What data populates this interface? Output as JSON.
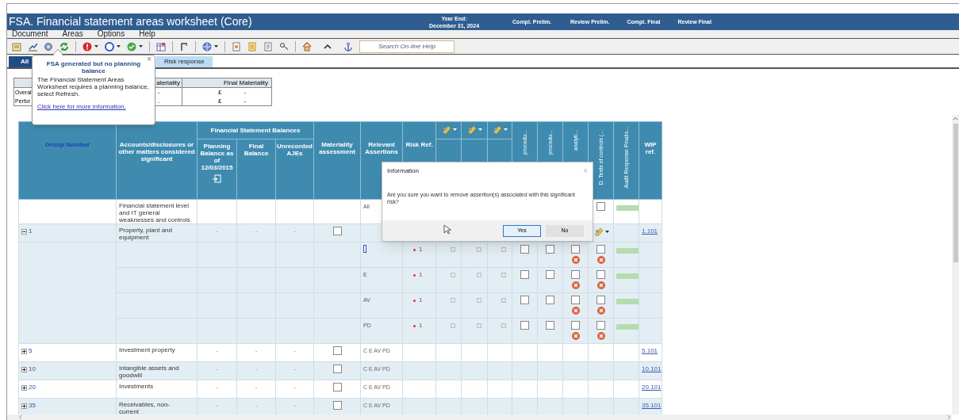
{
  "window": {
    "title": "FSA. Financial statement areas worksheet (Core)"
  },
  "header_fields": [
    {
      "label": "Year End:",
      "value": "December 31, 2024"
    },
    {
      "label": "Compl. Prelim."
    },
    {
      "label": "Review Prelim."
    },
    {
      "label": "Compl. Final"
    },
    {
      "label": "Review Final"
    }
  ],
  "menu": [
    "Document",
    "Areas",
    "Options",
    "Help"
  ],
  "toolbar": {
    "search_placeholder": "Search On-line Help"
  },
  "tabs": [
    {
      "label": "All",
      "selected": true
    },
    {
      "label": "Risk response",
      "selected": false
    }
  ],
  "materiality": {
    "columns": [
      "ateriality",
      "Final Materiality"
    ],
    "rows": [
      {
        "label": "Overal",
        "prelim": "-",
        "currency": "£",
        "final": "-"
      },
      {
        "label": "Perfor",
        "prelim": ".",
        "currency": "£",
        "final": "-"
      }
    ]
  },
  "popup": {
    "title": "FSA generated but no planning balance",
    "text": "The Financial Statement Areas Worksheet requires a planning balance, select Refresh.",
    "link": "Click here for more information.",
    "close": "×"
  },
  "table": {
    "balances_group": "Financial Statement Balances",
    "columns": [
      {
        "kind": "group_heading",
        "label": "Group Number"
      },
      {
        "kind": "text",
        "label": "Accounts/disclosures or other matters considered significant"
      },
      {
        "kind": "import",
        "label": "Planning Balance as of 12/03/2015"
      },
      {
        "kind": "text",
        "label": "Final Balance"
      },
      {
        "kind": "text",
        "label": "Unrecorded AJEs"
      },
      {
        "kind": "text",
        "label": "Materiality assessment"
      },
      {
        "kind": "text",
        "label": "Relevant Assertions"
      },
      {
        "kind": "text",
        "label": "Risk Ref."
      },
      {
        "kind": "icon_menu"
      },
      {
        "kind": "icon_menu"
      },
      {
        "kind": "icon_menu"
      },
      {
        "kind": "rotated_top",
        "label": "procedu..."
      },
      {
        "kind": "rotated_top",
        "label": "procedu..."
      },
      {
        "kind": "rotated_top",
        "label": "analyti..."
      },
      {
        "kind": "rotated",
        "label": "D. Tests of controls (..."
      },
      {
        "kind": "rotated",
        "label": "Audit Response Finalis..."
      },
      {
        "kind": "text",
        "label": "WIP ref."
      }
    ],
    "rows": [
      {
        "kind": "level",
        "name": "Financial statement level and IT general weaknesses and controls",
        "assertions": "All",
        "tests_checked": false
      },
      {
        "kind": "area",
        "group": "1",
        "expanded": true,
        "name": "Property, plant and equipment",
        "planning": "-",
        "final": "-",
        "unrecorded": "-",
        "materiality_checked": false,
        "wip": "1.101"
      },
      {
        "kind": "assertion",
        "editing": true,
        "risk": "1",
        "checks": [
          false,
          false,
          false,
          false
        ]
      },
      {
        "kind": "assertion",
        "assertion": "E",
        "risk": "1",
        "checks": [
          false,
          false,
          false,
          false
        ]
      },
      {
        "kind": "assertion",
        "assertion": "AV",
        "risk": "1",
        "checks": [
          false,
          false,
          false,
          false
        ]
      },
      {
        "kind": "assertion",
        "assertion": "PD",
        "risk": "1",
        "checks": [
          false,
          false,
          false,
          false
        ]
      },
      {
        "kind": "area",
        "group": "5",
        "expanded": false,
        "name": "Investment property",
        "planning": "-",
        "final": "-",
        "unrecorded": "-",
        "materiality_checked": false,
        "assertions": "C E AV PD",
        "wip": "5.101"
      },
      {
        "kind": "area",
        "group": "10",
        "expanded": false,
        "name": "Intangible assets and goodwill",
        "planning": "-",
        "final": "-",
        "unrecorded": "-",
        "materiality_checked": false,
        "assertions": "C E AV PD",
        "wip": "10.101"
      },
      {
        "kind": "area",
        "group": "20",
        "expanded": false,
        "name": "Investments",
        "planning": "-",
        "final": "-",
        "unrecorded": "-",
        "materiality_checked": false,
        "assertions": "C E AV PD",
        "wip": "20.101"
      },
      {
        "kind": "area",
        "group": "35",
        "expanded": false,
        "name": "Receivables, non-current",
        "planning": "-",
        "final": "-",
        "unrecorded": "-",
        "materiality_checked": false,
        "assertions": "C E AV PD",
        "wip": "35.101"
      }
    ]
  },
  "dialog": {
    "title": "Information",
    "close": "×",
    "message": "Are you sure you want to remove assertion(s) associated with this significant risk?",
    "buttons": [
      {
        "label": "Yes",
        "selected": true
      },
      {
        "label": "No",
        "selected": false
      }
    ]
  }
}
